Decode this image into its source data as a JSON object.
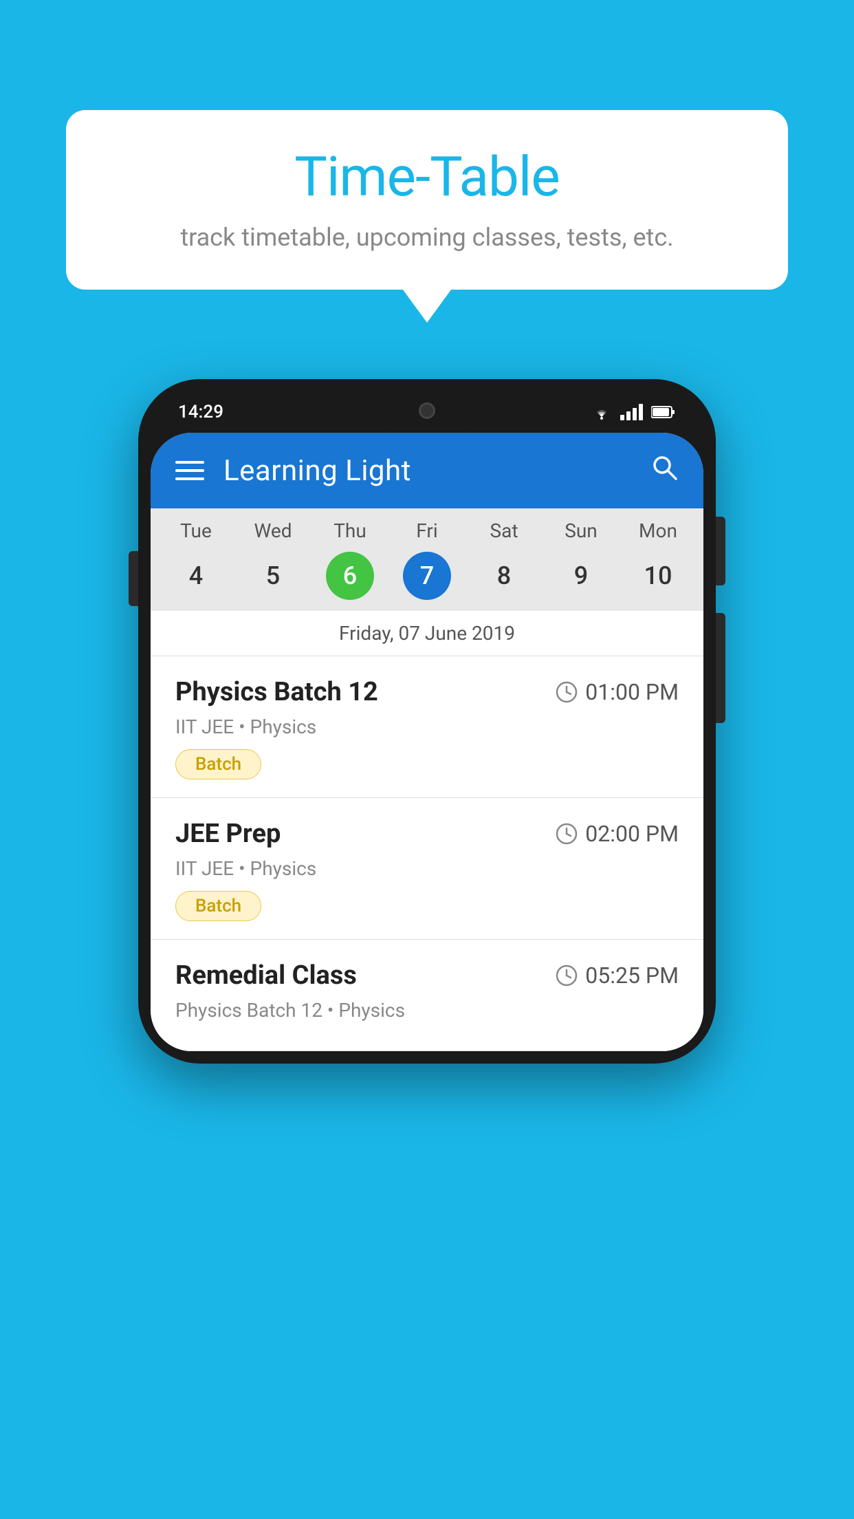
{
  "background_color": "#1ab6e8",
  "speech_bubble": {
    "title": "Time-Table",
    "subtitle": "track timetable, upcoming classes, tests, etc."
  },
  "phone": {
    "status_bar": {
      "time": "14:29"
    },
    "app_bar": {
      "title": "Learning Light"
    },
    "calendar": {
      "days": [
        {
          "name": "Tue",
          "number": "4",
          "state": "normal"
        },
        {
          "name": "Wed",
          "number": "5",
          "state": "normal"
        },
        {
          "name": "Thu",
          "number": "6",
          "state": "today"
        },
        {
          "name": "Fri",
          "number": "7",
          "state": "selected"
        },
        {
          "name": "Sat",
          "number": "8",
          "state": "normal"
        },
        {
          "name": "Sun",
          "number": "9",
          "state": "normal"
        },
        {
          "name": "Mon",
          "number": "10",
          "state": "normal"
        }
      ],
      "selected_date_label": "Friday, 07 June 2019"
    },
    "schedule": [
      {
        "title": "Physics Batch 12",
        "time": "01:00 PM",
        "meta": "IIT JEE • Physics",
        "badge": "Batch"
      },
      {
        "title": "JEE Prep",
        "time": "02:00 PM",
        "meta": "IIT JEE • Physics",
        "badge": "Batch"
      },
      {
        "title": "Remedial Class",
        "time": "05:25 PM",
        "meta": "Physics Batch 12 • Physics",
        "badge": null
      }
    ]
  }
}
